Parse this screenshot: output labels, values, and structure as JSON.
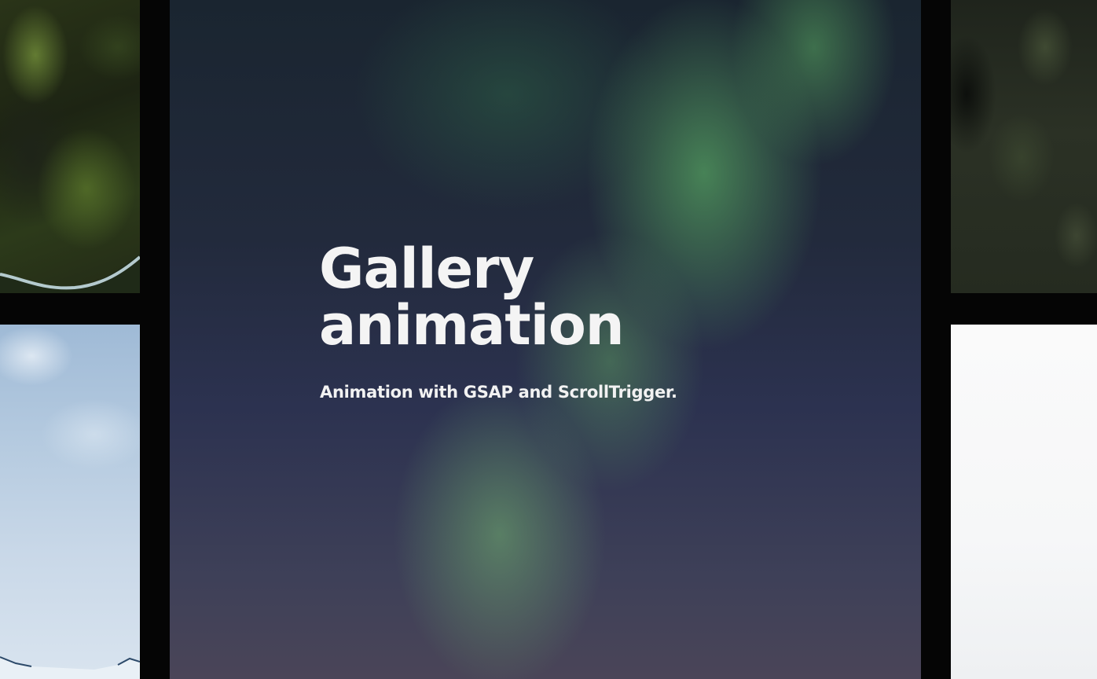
{
  "hero": {
    "title_line1": "Gallery",
    "title_line2": "animation",
    "subtitle": "Animation with GSAP and ScrollTrigger."
  },
  "colors": {
    "page_background": "#050505",
    "title_text": "#f4f4f4",
    "aurora_green": "#54a060",
    "night_sky": "#2c3250"
  }
}
